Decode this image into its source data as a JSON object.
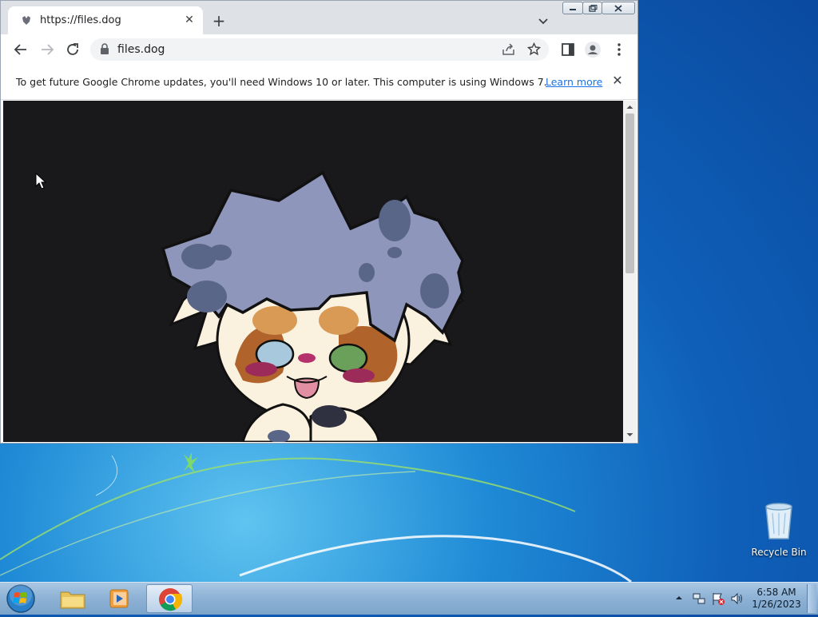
{
  "browser": {
    "tab": {
      "title": "https://files.dog",
      "close_glyph": "✕"
    },
    "new_tab_glyph": "+",
    "address": {
      "url": "files.dog"
    },
    "infobar": {
      "message": "To get future Google Chrome updates, you'll need Windows 10 or later. This computer is using Windows 7.",
      "link": "Learn more",
      "close_glyph": "✕"
    }
  },
  "desktop": {
    "recycle_bin_label": "Recycle Bin"
  },
  "taskbar": {
    "time": "6:58 AM",
    "date": "1/26/2023"
  },
  "colors": {
    "link": "#1a73e8",
    "page_background": "#19191b",
    "artwork_fur_blue": "#8e96bb",
    "artwork_spots": "#5a6688",
    "artwork_cream": "#fbf1df"
  }
}
